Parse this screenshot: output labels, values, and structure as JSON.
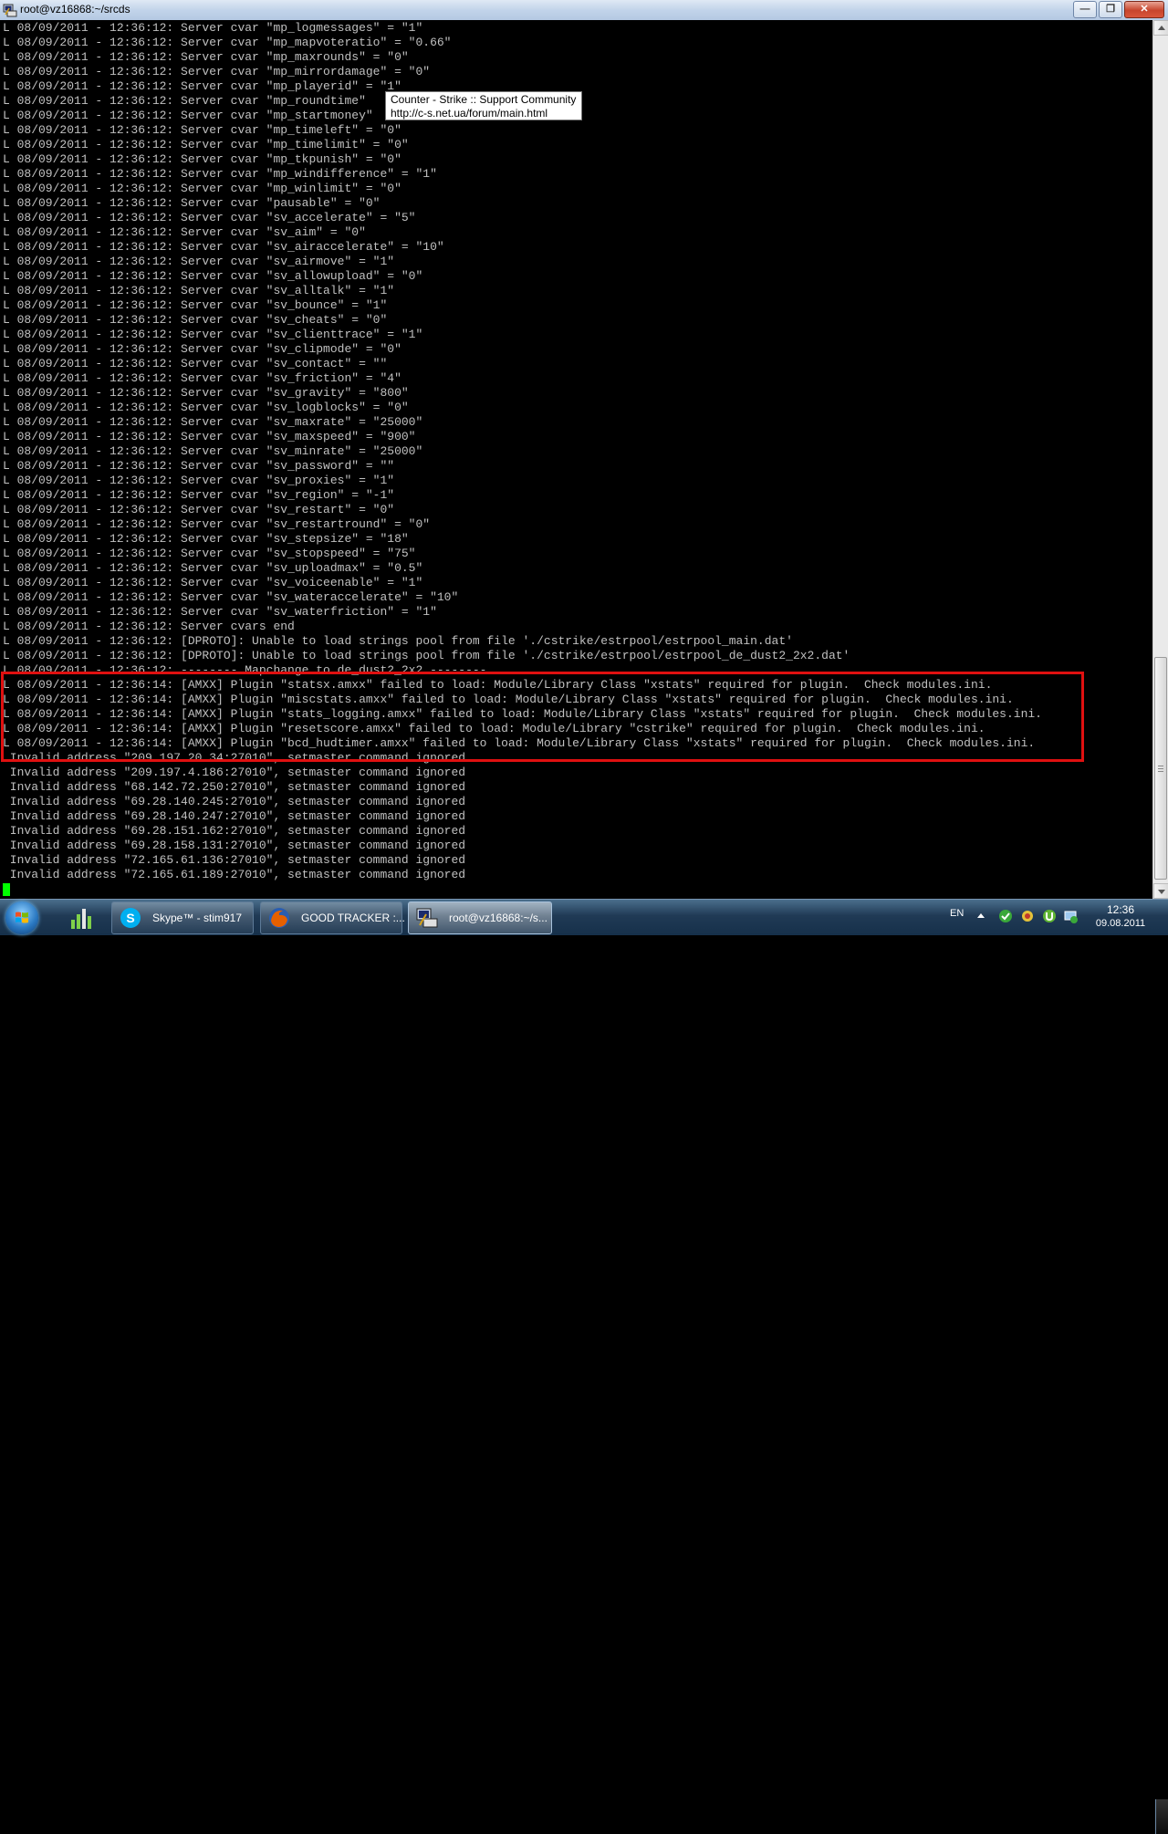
{
  "window": {
    "title": "root@vz16868:~/srcds",
    "buttons": {
      "minimize": "—",
      "maximize": "❐",
      "close": "✕"
    }
  },
  "terminal": {
    "lines": [
      "L 08/09/2011 - 12:36:12: Server cvar \"mp_logmessages\" = \"1\"",
      "L 08/09/2011 - 12:36:12: Server cvar \"mp_mapvoteratio\" = \"0.66\"",
      "L 08/09/2011 - 12:36:12: Server cvar \"mp_maxrounds\" = \"0\"",
      "L 08/09/2011 - 12:36:12: Server cvar \"mp_mirrordamage\" = \"0\"",
      "L 08/09/2011 - 12:36:12: Server cvar \"mp_playerid\" = \"1\"",
      "L 08/09/2011 - 12:36:12: Server cvar \"mp_roundtime\"",
      "L 08/09/2011 - 12:36:12: Server cvar \"mp_startmoney\"",
      "L 08/09/2011 - 12:36:12: Server cvar \"mp_timeleft\" = \"0\"",
      "L 08/09/2011 - 12:36:12: Server cvar \"mp_timelimit\" = \"0\"",
      "L 08/09/2011 - 12:36:12: Server cvar \"mp_tkpunish\" = \"0\"",
      "L 08/09/2011 - 12:36:12: Server cvar \"mp_windifference\" = \"1\"",
      "L 08/09/2011 - 12:36:12: Server cvar \"mp_winlimit\" = \"0\"",
      "L 08/09/2011 - 12:36:12: Server cvar \"pausable\" = \"0\"",
      "L 08/09/2011 - 12:36:12: Server cvar \"sv_accelerate\" = \"5\"",
      "L 08/09/2011 - 12:36:12: Server cvar \"sv_aim\" = \"0\"",
      "L 08/09/2011 - 12:36:12: Server cvar \"sv_airaccelerate\" = \"10\"",
      "L 08/09/2011 - 12:36:12: Server cvar \"sv_airmove\" = \"1\"",
      "L 08/09/2011 - 12:36:12: Server cvar \"sv_allowupload\" = \"0\"",
      "L 08/09/2011 - 12:36:12: Server cvar \"sv_alltalk\" = \"1\"",
      "L 08/09/2011 - 12:36:12: Server cvar \"sv_bounce\" = \"1\"",
      "L 08/09/2011 - 12:36:12: Server cvar \"sv_cheats\" = \"0\"",
      "L 08/09/2011 - 12:36:12: Server cvar \"sv_clienttrace\" = \"1\"",
      "L 08/09/2011 - 12:36:12: Server cvar \"sv_clipmode\" = \"0\"",
      "L 08/09/2011 - 12:36:12: Server cvar \"sv_contact\" = \"\"",
      "L 08/09/2011 - 12:36:12: Server cvar \"sv_friction\" = \"4\"",
      "L 08/09/2011 - 12:36:12: Server cvar \"sv_gravity\" = \"800\"",
      "L 08/09/2011 - 12:36:12: Server cvar \"sv_logblocks\" = \"0\"",
      "L 08/09/2011 - 12:36:12: Server cvar \"sv_maxrate\" = \"25000\"",
      "L 08/09/2011 - 12:36:12: Server cvar \"sv_maxspeed\" = \"900\"",
      "L 08/09/2011 - 12:36:12: Server cvar \"sv_minrate\" = \"25000\"",
      "L 08/09/2011 - 12:36:12: Server cvar \"sv_password\" = \"\"",
      "L 08/09/2011 - 12:36:12: Server cvar \"sv_proxies\" = \"1\"",
      "L 08/09/2011 - 12:36:12: Server cvar \"sv_region\" = \"-1\"",
      "L 08/09/2011 - 12:36:12: Server cvar \"sv_restart\" = \"0\"",
      "L 08/09/2011 - 12:36:12: Server cvar \"sv_restartround\" = \"0\"",
      "L 08/09/2011 - 12:36:12: Server cvar \"sv_stepsize\" = \"18\"",
      "L 08/09/2011 - 12:36:12: Server cvar \"sv_stopspeed\" = \"75\"",
      "L 08/09/2011 - 12:36:12: Server cvar \"sv_uploadmax\" = \"0.5\"",
      "L 08/09/2011 - 12:36:12: Server cvar \"sv_voiceenable\" = \"1\"",
      "L 08/09/2011 - 12:36:12: Server cvar \"sv_wateraccelerate\" = \"10\"",
      "L 08/09/2011 - 12:36:12: Server cvar \"sv_waterfriction\" = \"1\"",
      "L 08/09/2011 - 12:36:12: Server cvars end",
      "L 08/09/2011 - 12:36:12: [DPROTO]: Unable to load strings pool from file './cstrike/estrpool/estrpool_main.dat'",
      "L 08/09/2011 - 12:36:12: [DPROTO]: Unable to load strings pool from file './cstrike/estrpool/estrpool_de_dust2_2x2.dat'",
      "L 08/09/2011 - 12:36:12: -------- Mapchange to de_dust2_2x2 --------",
      "L 08/09/2011 - 12:36:14: [AMXX] Plugin \"statsx.amxx\" failed to load: Module/Library Class \"xstats\" required for plugin.  Check modules.ini.",
      "L 08/09/2011 - 12:36:14: [AMXX] Plugin \"miscstats.amxx\" failed to load: Module/Library Class \"xstats\" required for plugin.  Check modules.ini.",
      "L 08/09/2011 - 12:36:14: [AMXX] Plugin \"stats_logging.amxx\" failed to load: Module/Library Class \"xstats\" required for plugin.  Check modules.ini.",
      "L 08/09/2011 - 12:36:14: [AMXX] Plugin \"resetscore.amxx\" failed to load: Module/Library \"cstrike\" required for plugin.  Check modules.ini.",
      "L 08/09/2011 - 12:36:14: [AMXX] Plugin \"bcd_hudtimer.amxx\" failed to load: Module/Library Class \"xstats\" required for plugin.  Check modules.ini.",
      " Invalid address \"209.197.20.34:27010\", setmaster command ignored",
      " Invalid address \"209.197.4.186:27010\", setmaster command ignored",
      " Invalid address \"68.142.72.250:27010\", setmaster command ignored",
      " Invalid address \"69.28.140.245:27010\", setmaster command ignored",
      " Invalid address \"69.28.140.247:27010\", setmaster command ignored",
      " Invalid address \"69.28.151.162:27010\", setmaster command ignored",
      " Invalid address \"69.28.158.131:27010\", setmaster command ignored",
      " Invalid address \"72.165.61.136:27010\", setmaster command ignored",
      " Invalid address \"72.165.61.189:27010\", setmaster command ignored"
    ],
    "cursor_color": "#00ff00",
    "text_color": "#c0c0c0"
  },
  "tooltip": {
    "line1": "Counter - Strike :: Support Community",
    "line2": "http://c-s.net.ua/forum/main.html"
  },
  "highlight_color": "#e01010",
  "taskbar": {
    "start_icon": "windows-logo-icon",
    "tasks": [
      {
        "label": "Skype™ - stim917",
        "icon": "skype-icon"
      },
      {
        "label": "GOOD TRACKER :...",
        "icon": "firefox-icon"
      },
      {
        "label": "root@vz16868:~/s...",
        "icon": "putty-icon"
      }
    ],
    "tray": {
      "language": "EN",
      "time": "12:36",
      "date": "09.08.2011"
    }
  }
}
